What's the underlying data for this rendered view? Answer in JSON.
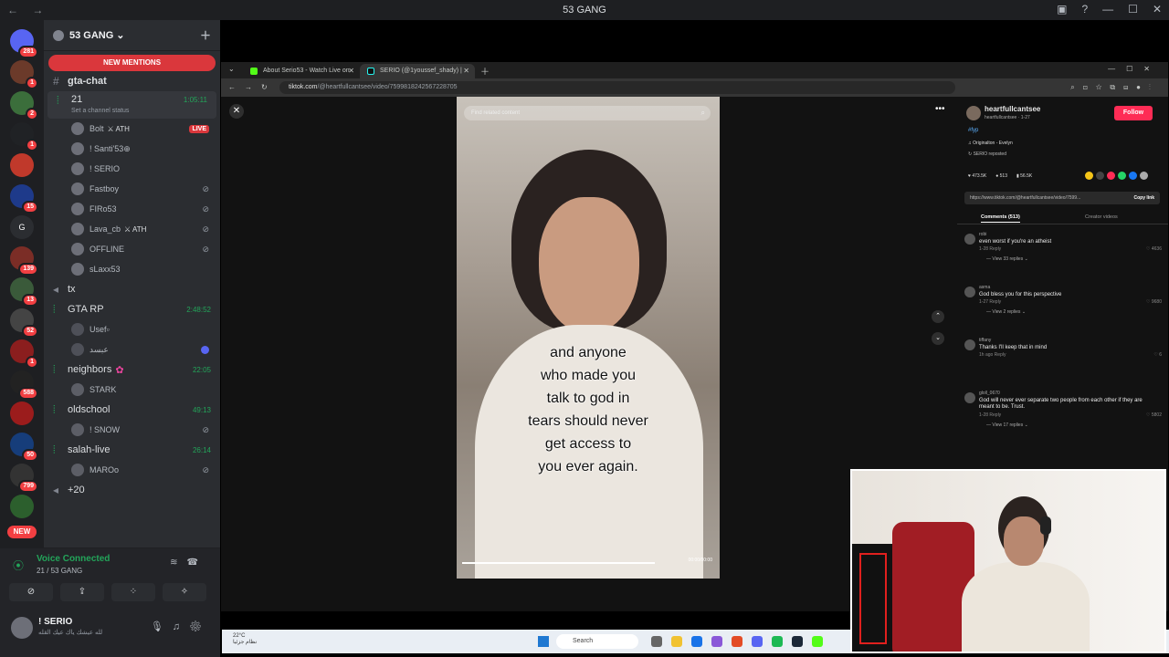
{
  "titlebar": {
    "title": "53 GANG",
    "back": "←",
    "fwd": "→"
  },
  "servers": [
    {
      "label": "",
      "badge": "281",
      "color": "#5865f2"
    },
    {
      "label": "",
      "badge": "1",
      "color": "#6b3a2a"
    },
    {
      "label": "",
      "badge": "2",
      "color": "#3b6e3b"
    },
    {
      "label": "",
      "badge": "1",
      "color": "#202225"
    },
    {
      "label": "",
      "badge": "",
      "color": "#c0392b"
    },
    {
      "label": "",
      "badge": "15",
      "color": "#1e3a8a"
    },
    {
      "label": "G",
      "badge": "",
      "color": "#2b2d31"
    },
    {
      "label": "",
      "badge": "139",
      "color": "#7b2d26"
    },
    {
      "label": "",
      "badge": "13",
      "color": "#3a5a3a"
    },
    {
      "label": "",
      "badge": "52",
      "color": "#444"
    },
    {
      "label": "",
      "badge": "1",
      "color": "#8b1e1e"
    },
    {
      "label": "",
      "badge": "588",
      "color": "#222"
    },
    {
      "label": "",
      "badge": "",
      "color": "#9b1c1c"
    },
    {
      "label": "",
      "badge": "50",
      "color": "#163d7a"
    },
    {
      "label": "",
      "badge": "799",
      "color": "#333"
    },
    {
      "label": "",
      "badge": "",
      "color": "#2c5f2d"
    }
  ],
  "new_tag": "NEW",
  "guild": {
    "name": "53 GANG",
    "chevron": "⌄",
    "new_mentions": "NEW MENTIONS"
  },
  "channels": {
    "gta_chat": "gta-chat",
    "active": {
      "name": "21",
      "time": "1:05:11",
      "status": "Set a channel status"
    },
    "users21": [
      {
        "name": "Bolt",
        "tag": "⚔ ATH",
        "flag": "LIVE"
      },
      {
        "name": "! Santi'53⊕",
        "tag": "",
        "flag": ""
      },
      {
        "name": "! SERIO",
        "tag": "",
        "flag": ""
      },
      {
        "name": "Fastboy",
        "tag": "",
        "flag": "mute"
      },
      {
        "name": "FIRo53",
        "tag": "",
        "flag": "mute"
      },
      {
        "name": "Lava_cb",
        "tag": "⚔ ATH",
        "flag": "mute"
      },
      {
        "name": "OFFLINE",
        "tag": "",
        "flag": "mute"
      },
      {
        "name": "sLaxx53",
        "tag": "",
        "flag": ""
      }
    ],
    "tx": "tx",
    "gta_rp": {
      "name": "GTA RP",
      "time": "2:48:52"
    },
    "gta_users": [
      {
        "name": "Usef▫",
        "flag": ""
      },
      {
        "name": "عبسد",
        "flag": "shield"
      }
    ],
    "neighbors": {
      "name": "neighbors",
      "time": "22:05"
    },
    "neighbors_users": [
      {
        "name": "STARK",
        "flag": ""
      }
    ],
    "oldschool": {
      "name": "oldschool",
      "time": "49:13"
    },
    "oldschool_users": [
      {
        "name": "! SNOW",
        "flag": "mute"
      }
    ],
    "salah": {
      "name": "salah-live",
      "time": "26:14"
    },
    "salah_users": [
      {
        "name": "MAROo",
        "flag": "mute"
      }
    ],
    "more": "+20"
  },
  "voice": {
    "status": "Voice Connected",
    "sub": "21 / 53 GANG"
  },
  "user": {
    "name": "! SERIO",
    "status": "لله عيشك ياك عيك القله"
  },
  "browser": {
    "tabs": [
      {
        "label": "About Serio53 - Watch Live on",
        "color": "#53fc18"
      },
      {
        "label": "SERIO (@1youssef_shady) |",
        "color": "#000"
      }
    ],
    "url_host": "tiktok.com",
    "url_path": "/@heartfullcantsee/video/7599818242567228705"
  },
  "tiktok": {
    "search_placeholder": "Find related content",
    "caption": [
      "and anyone",
      "who made you",
      "talk to god in",
      "tears should never",
      "get access to",
      "you ever again."
    ],
    "video_time": "00:00/00:00",
    "progress": 0.78,
    "creator": "heartfullcantsee",
    "creator_sub": "heartfullcantsee · 1-27",
    "follow": "Follow",
    "hashtag": "#fyp",
    "music": "♫ Originalton - Evelyn",
    "reposted": "↻ SERIO reposted",
    "stats": [
      "473.5K",
      "513",
      "56.5K"
    ],
    "link": "https://www.tiktok.com/@heartfullcantsee/video/7599...",
    "copy": "Copy link",
    "tab_comments": "Comments (513)",
    "tab_creator": "Creator videos",
    "comments": [
      {
        "user": "robi",
        "text": "even worst if you're an atheist",
        "meta": "1-28   Reply",
        "likes": "♡ 4636",
        "replies": "— View 33 replies ⌄"
      },
      {
        "user": "asma",
        "text": "God bless you for this perspective",
        "meta": "1-27   Reply",
        "likes": "♡ 9680",
        "replies": "— View 2 replies ⌄"
      },
      {
        "user": "tiffany",
        "text": "Thanks I'll keep that in mind",
        "meta": "1h ago   Reply",
        "likes": "♡ 6",
        "replies": ""
      },
      {
        "user": "gloll_0670",
        "text": "God will never ever separate two people from each other if they are meant to be. Trust.",
        "meta": "1-28   Reply",
        "likes": "♡ 5802",
        "replies": "— View 17 replies ⌄"
      }
    ]
  },
  "taskbar": {
    "weather_temp": "22°C",
    "weather_text": "نظام جزئيا",
    "search": "Search"
  }
}
